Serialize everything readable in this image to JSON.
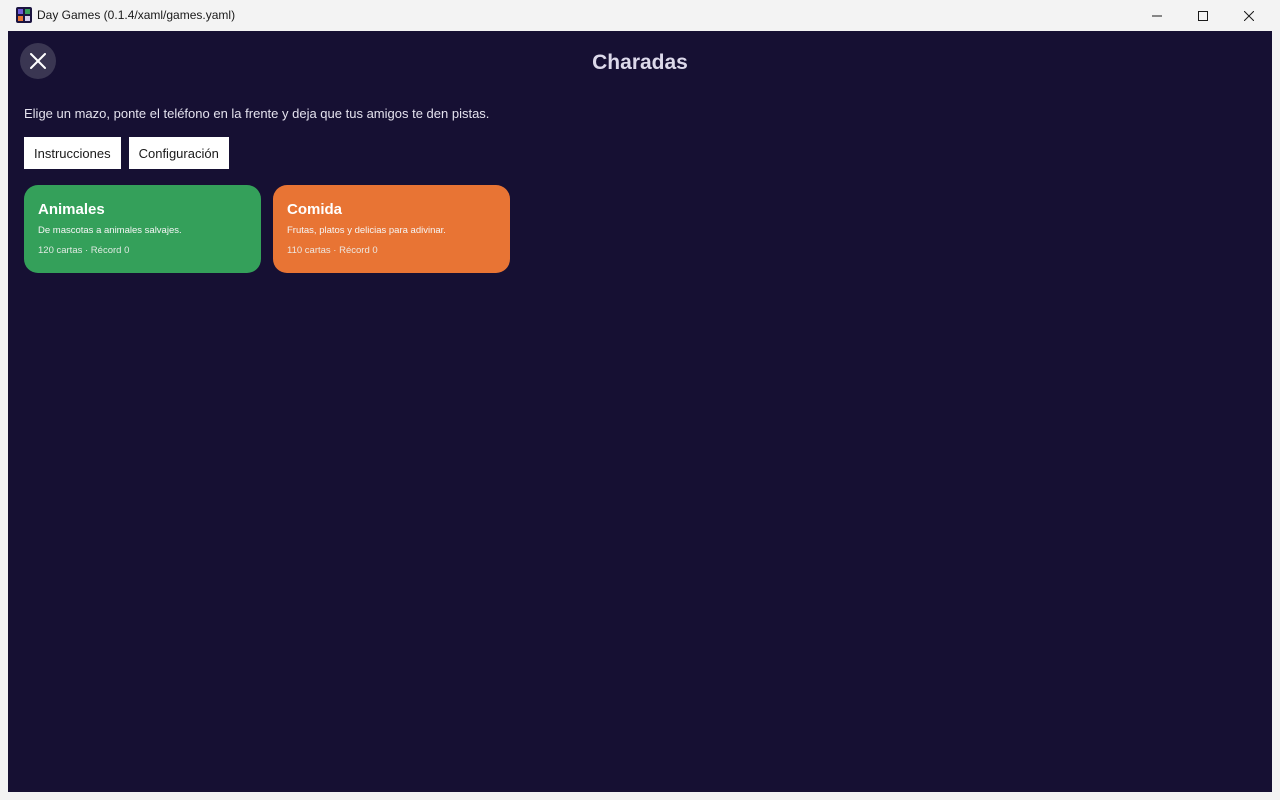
{
  "window": {
    "title": "Day Games (0.1.4/xaml/games.yaml)",
    "icon": "app-icon",
    "controls": [
      "minimize-icon",
      "maximize-icon",
      "close-icon"
    ]
  },
  "header": {
    "title": "Charadas",
    "back_icon": "close-icon"
  },
  "main": {
    "description": "Elige un mazo, ponte el teléfono en la frente y deja que tus amigos te den pistas.",
    "buttons": {
      "instructions": "Instrucciones",
      "settings": "Configuración"
    },
    "decks": [
      {
        "name": "Animales",
        "description": "De mascotas a animales salvajes.",
        "meta": "120 cartas · Récord 0",
        "color": "#34a05a"
      },
      {
        "name": "Comida",
        "description": "Frutas, platos y delicias para adivinar.",
        "meta": "110 cartas · Récord 0",
        "color": "#e87434"
      }
    ]
  },
  "colors": {
    "background": "#161033",
    "title_text": "#dcd9ea",
    "chrome": "#f3f3f3"
  }
}
